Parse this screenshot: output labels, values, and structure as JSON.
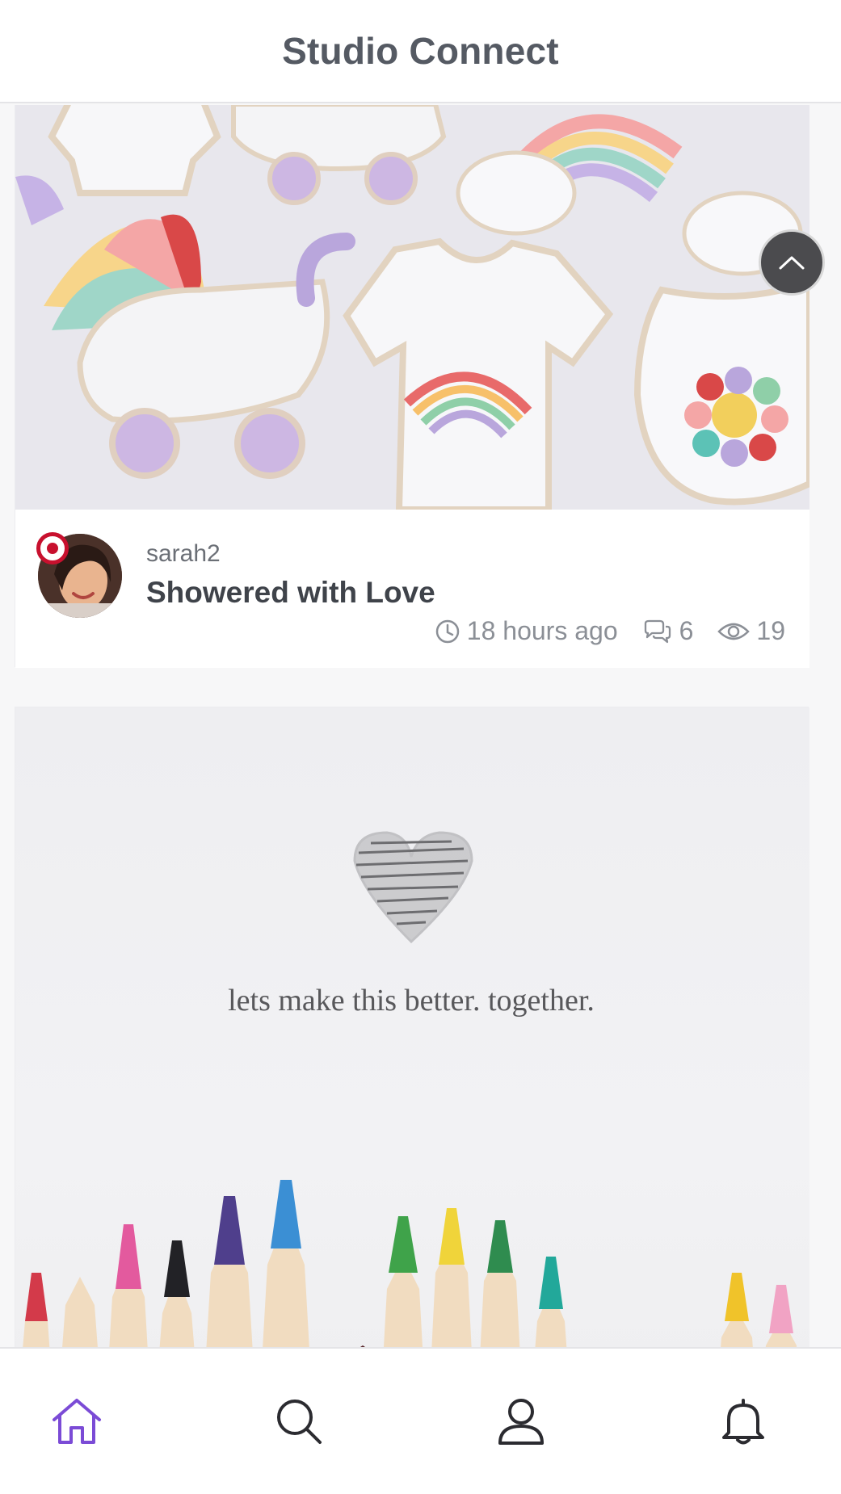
{
  "header": {
    "title": "Studio Connect"
  },
  "scroll_top": {
    "icon": "chevron-up-icon"
  },
  "posts": [
    {
      "image": "decorated-baby-shower-cookies",
      "author": "sarah2",
      "title": "Showered with Love",
      "time": "18 hours ago",
      "comments": "6",
      "views": "19",
      "badge": "red-target-badge"
    },
    {
      "image": "colored-pencils-heart",
      "caption": "lets make this better. together."
    }
  ],
  "tabbar": {
    "active": "home",
    "accent": "#7b4bd6",
    "items": [
      {
        "name": "home",
        "icon": "home-icon"
      },
      {
        "name": "search",
        "icon": "search-icon"
      },
      {
        "name": "profile",
        "icon": "user-icon"
      },
      {
        "name": "notifications",
        "icon": "bell-icon"
      }
    ]
  },
  "colors": {
    "header_text": "#555a63",
    "title_text": "#3f434a",
    "meta_text": "#8b8f96",
    "badge_red": "#c8102e"
  }
}
